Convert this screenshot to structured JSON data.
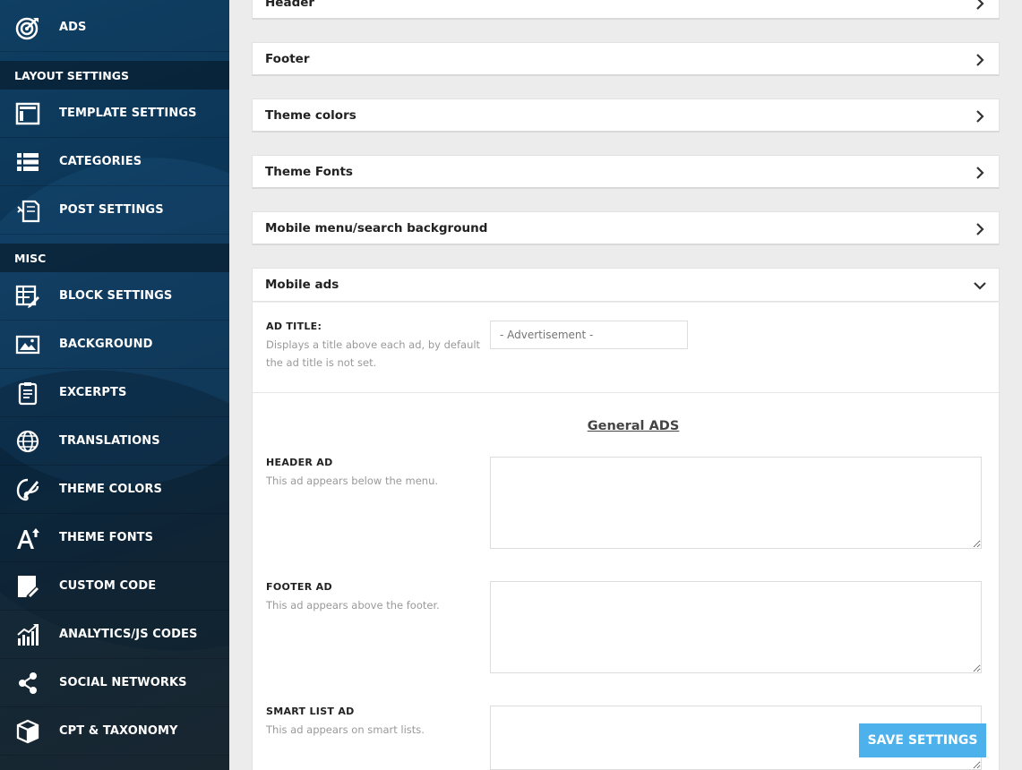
{
  "sidebar": {
    "items": [
      {
        "label": "ADS",
        "icon": "target-icon"
      },
      {
        "label": "TEMPLATE SETTINGS",
        "icon": "template-icon"
      },
      {
        "label": "CATEGORIES",
        "icon": "list-icon"
      },
      {
        "label": "POST SETTINGS",
        "icon": "post-icon"
      },
      {
        "label": "BLOCK SETTINGS",
        "icon": "block-icon"
      },
      {
        "label": "BACKGROUND",
        "icon": "image-icon"
      },
      {
        "label": "EXCERPTS",
        "icon": "clipboard-icon"
      },
      {
        "label": "TRANSLATIONS",
        "icon": "globe-icon"
      },
      {
        "label": "THEME COLORS",
        "icon": "brush-icon"
      },
      {
        "label": "THEME FONTS",
        "icon": "font-icon"
      },
      {
        "label": "CUSTOM CODE",
        "icon": "code-edit-icon"
      },
      {
        "label": "ANALYTICS/JS CODES",
        "icon": "analytics-icon"
      },
      {
        "label": "SOCIAL NETWORKS",
        "icon": "share-icon"
      },
      {
        "label": "CPT & TAXONOMY",
        "icon": "box-icon"
      }
    ],
    "sections": {
      "layout": "LAYOUT SETTINGS",
      "misc": "MISC"
    }
  },
  "panels": [
    {
      "title": "Header",
      "state": "collapsed"
    },
    {
      "title": "Footer",
      "state": "collapsed"
    },
    {
      "title": "Theme colors",
      "state": "collapsed"
    },
    {
      "title": "Theme Fonts",
      "state": "collapsed"
    },
    {
      "title": "Mobile menu/search background",
      "state": "collapsed"
    },
    {
      "title": "Mobile ads",
      "state": "expanded"
    }
  ],
  "mobile_ads": {
    "ad_title": {
      "label": "AD TITLE:",
      "description": "Displays a title above each ad, by default the ad title is not set.",
      "placeholder": "- Advertisement -"
    },
    "section_heading": "General ADS",
    "header_ad": {
      "label": "HEADER AD",
      "description": "This ad appears below the menu."
    },
    "footer_ad": {
      "label": "FOOTER AD",
      "description": "This ad appears above the footer."
    },
    "smart_list_ad": {
      "label": "SMART LIST AD",
      "description": "This ad appears on smart lists."
    }
  },
  "save_button": "SAVE SETTINGS",
  "colors": {
    "accent": "#4db2ec",
    "sidebar_bg": "#0c3556",
    "page_bg": "#ececec"
  }
}
